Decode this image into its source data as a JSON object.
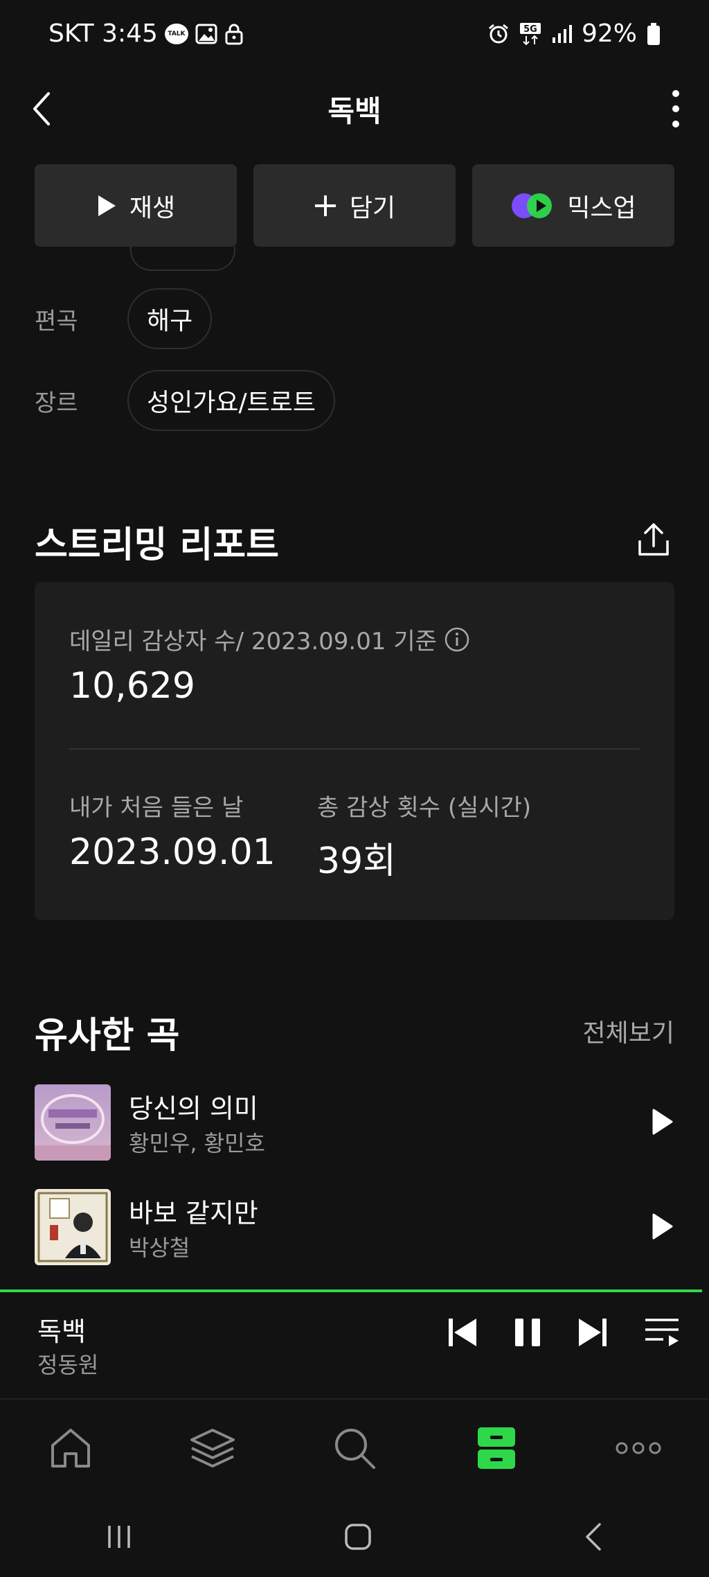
{
  "status_bar": {
    "carrier_time": "SKT 3:45",
    "talk_icon_text": "TALK",
    "battery": "92%"
  },
  "header": {
    "title": "독백"
  },
  "actions": {
    "play": "재생",
    "add": "담기",
    "mixup": "믹스업"
  },
  "meta": [
    {
      "label": "편곡",
      "value": "해구"
    },
    {
      "label": "장르",
      "value": "성인가요/트로트"
    }
  ],
  "report": {
    "title": "스트리밍 리포트",
    "daily_label": "데일리 감상자 수/ 2023.09.01 기준",
    "daily_value": "10,629",
    "first_label": "내가 처음 들은 날",
    "first_value": "2023.09.01",
    "total_label": "총 감상 횟수 (실시간)",
    "total_value": "39회"
  },
  "similar": {
    "title": "유사한 곡",
    "see_all": "전체보기",
    "songs": [
      {
        "title": "당신의 의미",
        "artist": "황민우, 황민호"
      },
      {
        "title": "바보 같지만",
        "artist": "박상철"
      }
    ]
  },
  "now_playing": {
    "title": "독백",
    "artist": "정동원",
    "progress": 0.99
  },
  "colors": {
    "accent": "#2ed84a",
    "background": "#121212",
    "card": "#1e1e1e"
  }
}
